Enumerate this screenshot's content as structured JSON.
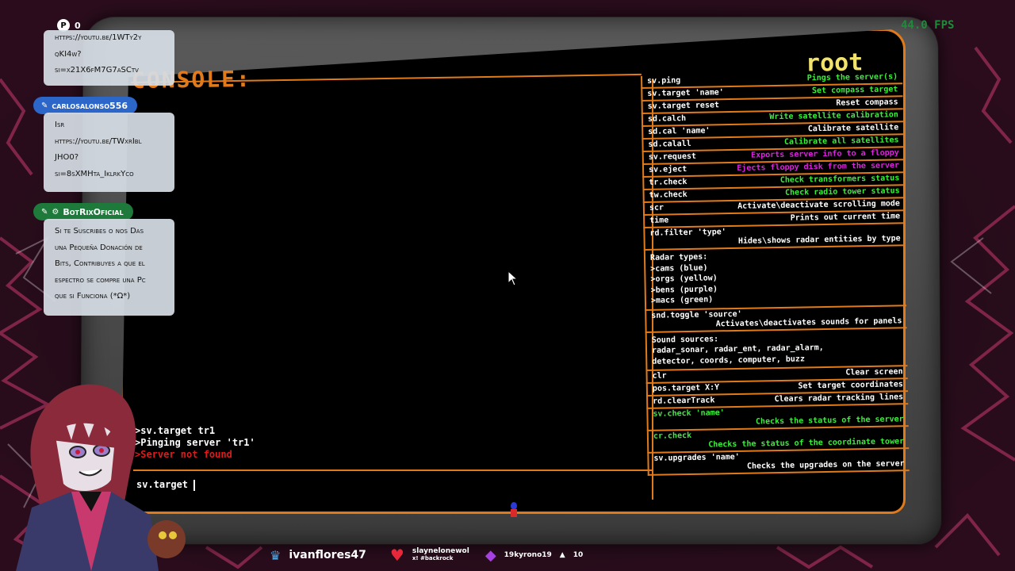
{
  "hud": {
    "fps": "44.0 FPS",
    "coin_icon": "P",
    "coin_count": "0"
  },
  "console": {
    "title": "CONSOLE:",
    "user": "root",
    "output": [
      ">sv.target tr1",
      ">Pinging server 'tr1'",
      ">Server not found"
    ],
    "input_value": "sv.target "
  },
  "commands": [
    {
      "cmd": "sv.ping",
      "desc": "Pings the server(s)",
      "color": "green"
    },
    {
      "cmd": "sv.target 'name'",
      "desc": "Set compass target",
      "color": "green"
    },
    {
      "cmd": "sv.target reset",
      "desc": "Reset compass",
      "color": "white"
    },
    {
      "cmd": "sd.calch",
      "desc": "Write satellite calibration",
      "color": "green"
    },
    {
      "cmd": "sd.cal 'name'",
      "desc": "Calibrate satellite",
      "color": "white"
    },
    {
      "cmd": "sd.calall",
      "desc": "Calibrate all satellites",
      "color": "green"
    },
    {
      "cmd": "sv.request",
      "desc": "Exports server info to a floppy",
      "color": "magenta"
    },
    {
      "cmd": "sv.eject",
      "desc": "Ejects floppy disk from the server",
      "color": "magenta"
    },
    {
      "cmd": "tr.check",
      "desc": "Check transformers status",
      "color": "green"
    },
    {
      "cmd": "tw.check",
      "desc": "Check radio tower status",
      "color": "green"
    },
    {
      "cmd": "scr",
      "desc": "Activate\\deactivate scrolling mode",
      "color": "white"
    },
    {
      "cmd": "time",
      "desc": "Prints out current time",
      "color": "white"
    }
  ],
  "rd_filter": {
    "cmd": "rd.filter 'type'",
    "desc": "Hides\\shows radar entities by type"
  },
  "radar_types": {
    "title": "Radar types:",
    "items": [
      ">cams (blue)",
      ">orgs (yellow)",
      ">bens (purple)",
      ">macs (green)"
    ]
  },
  "snd_toggle": {
    "cmd": "snd.toggle 'source'",
    "desc": "Activates\\deactivates sounds for panels"
  },
  "sound_sources": {
    "title": "Sound sources:",
    "lines": [
      "radar_sonar, radar_ent, radar_alarm,",
      "detector, coords, computer, buzz"
    ]
  },
  "commands2": [
    {
      "cmd": "clr",
      "desc": "Clear screen",
      "color": "white"
    },
    {
      "cmd": "pos.target X:Y",
      "desc": "Set target coordinates",
      "color": "white"
    },
    {
      "cmd": "rd.clearTrack",
      "desc": "Clears radar tracking lines",
      "color": "white"
    }
  ],
  "commands3": [
    {
      "cmd": "sv.check 'name'",
      "desc": "Checks the status of the server",
      "color": "green"
    },
    {
      "cmd": "cr.check",
      "desc": "Checks the status of the coordinate tower",
      "color": "green"
    },
    {
      "cmd": "sv.upgrades 'name'",
      "desc": "Checks the upgrades on the server",
      "color": "white"
    }
  ],
  "chat": {
    "msg1_lines": [
      "https://youtu.be/1WTy2y",
      "qKI4w?",
      "si=x21X6fM7G7aSCtv"
    ],
    "user2": "carlosalonso556",
    "msg2_lines": [
      "Isr",
      "https://youtu.be/TWxrIbl",
      "JHO0?",
      "si=8sXMHta_IklrkYco"
    ],
    "user3": "BotRixOficial",
    "msg3_lines": [
      "Si te Suscribes o nos Das",
      "una Pequeña Donación de",
      "Bits, Contribuyes a que el",
      "espectro se compre una Pc",
      "que si Funciona (*Ω*)"
    ]
  },
  "bottom_bar": {
    "top_name": "ivanflores47",
    "follower_1": "slaynelonewol",
    "follower_2": "x! #backrock",
    "sub_text": "19kyrono19",
    "sub_count": "10"
  }
}
